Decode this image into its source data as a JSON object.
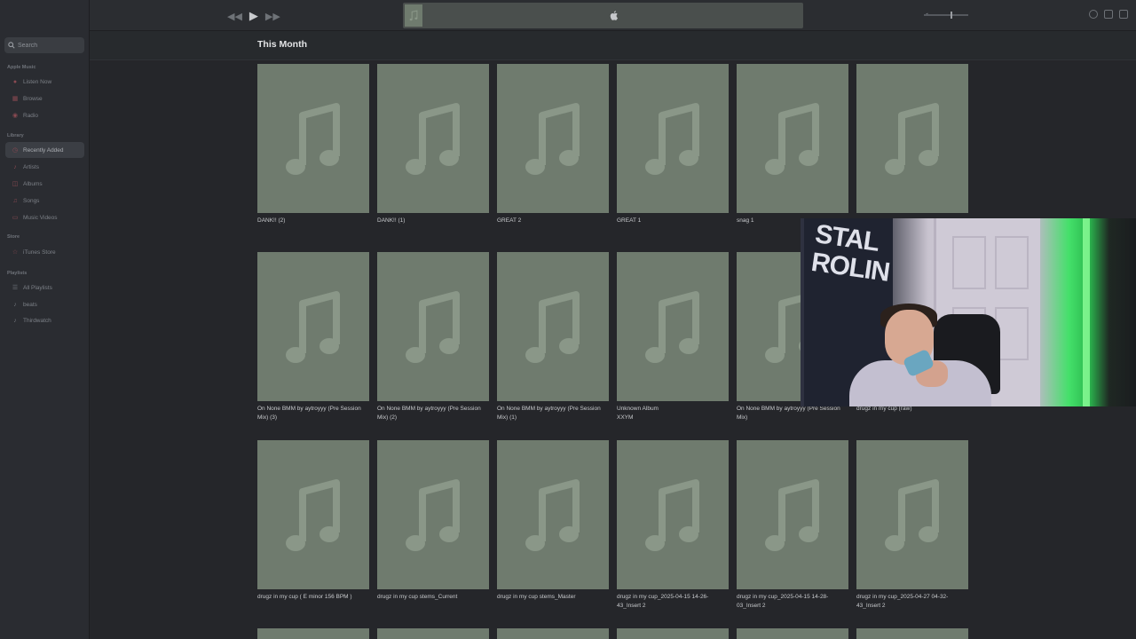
{
  "search": {
    "placeholder": "Search"
  },
  "sidebar": {
    "sections": [
      {
        "title": "Apple Music",
        "items": [
          "Listen Now",
          "Browse",
          "Radio"
        ]
      },
      {
        "title": "Library",
        "items": [
          "Recently Added",
          "Artists",
          "Albums",
          "Songs",
          "Music Videos"
        ]
      },
      {
        "title": "Store",
        "items": [
          "iTunes Store"
        ]
      },
      {
        "title": "Playlists",
        "items": [
          "All Playlists",
          "beats",
          "Thirdwatch"
        ]
      }
    ],
    "active_item": "Recently Added"
  },
  "main": {
    "title": "This Month",
    "albums": [
      {
        "name": "DANK!! (2)",
        "sub": ""
      },
      {
        "name": "DANK!! (1)",
        "sub": ""
      },
      {
        "name": "GREAT 2",
        "sub": ""
      },
      {
        "name": "GREAT 1",
        "sub": ""
      },
      {
        "name": "snag 1",
        "sub": ""
      },
      {
        "name": "",
        "sub": ""
      },
      {
        "name": "On None BMM by aytroyyy (Pre Session Mix) (3)",
        "sub": ""
      },
      {
        "name": "On None BMM by aytroyyy (Pre Session Mix) (2)",
        "sub": ""
      },
      {
        "name": "On None BMM by aytroyyy (Pre Session Mix) (1)",
        "sub": ""
      },
      {
        "name": "Unknown Album",
        "sub": "XXYM"
      },
      {
        "name": "On None BMM by aytroyyy (Pre Session Mix)",
        "sub": ""
      },
      {
        "name": "drugz in my cup (raw)",
        "sub": ""
      },
      {
        "name": "drugz in my cup ( E minor 156 BPM )",
        "sub": ""
      },
      {
        "name": "drugz in my cup stems_Current",
        "sub": ""
      },
      {
        "name": "drugz in my cup stems_Master",
        "sub": ""
      },
      {
        "name": "drugz in my cup_2025-04-15 14-26-43_Insert 2",
        "sub": ""
      },
      {
        "name": "drugz in my cup_2025-04-15 14-28-03_Insert 2",
        "sub": ""
      },
      {
        "name": "drugz in my cup_2025-04-27 04-32-43_Insert 2",
        "sub": ""
      }
    ]
  },
  "webcam": {
    "flag_text": "STAL\nROLIN"
  },
  "colors": {
    "cover": "#6f7b6e",
    "note": "#8a9788",
    "background": "#25262a",
    "sidebar": "#2a2c31"
  }
}
